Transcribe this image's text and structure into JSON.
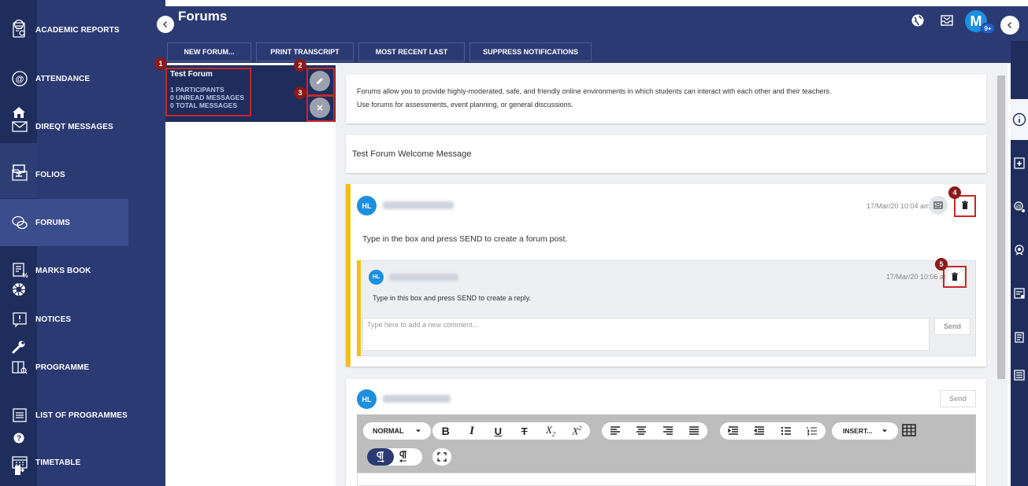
{
  "header": {
    "title": "Forums",
    "avatar_initial": "M",
    "badge": "9+"
  },
  "toolbar": {
    "new_forum": "NEW FORUM...",
    "print_transcript": "PRINT TRANSCRIPT",
    "most_recent_last": "MOST RECENT LAST",
    "suppress_notifications": "SUPPRESS NOTIFICATIONS"
  },
  "nav": {
    "items": [
      {
        "label": "ACADEMIC REPORTS"
      },
      {
        "label": "ATTENDANCE"
      },
      {
        "label": "DIREQT MESSAGES"
      },
      {
        "label": "FOLIOS"
      },
      {
        "label": "FORUMS"
      },
      {
        "label": "MARKS BOOK"
      },
      {
        "label": "NOTICES"
      },
      {
        "label": "PROGRAMME"
      },
      {
        "label": "LIST OF PROGRAMMES"
      },
      {
        "label": "TIMETABLE"
      }
    ]
  },
  "forum": {
    "title": "Test Forum",
    "participants": "1 PARTICIPANTS",
    "unread": "0 UNREAD MESSAGES",
    "total": "0 TOTAL MESSAGES"
  },
  "callouts": [
    "1",
    "2",
    "3",
    "4",
    "5"
  ],
  "content": {
    "info_line1": "Forums allow you to provide highly-moderated, safe, and friendly online environments in which students can interact with each other and their teachers.",
    "info_line2": "Use forums for assessments, event planning, or general discussions.",
    "welcome": "Test Forum Welcome Message"
  },
  "post": {
    "initials": "HL",
    "timestamp": "17/Mar/20 10:04 am",
    "text": "Type in the box and press SEND to create a forum post."
  },
  "reply": {
    "initials": "HL",
    "timestamp": "17/Mar/20 10:06 am",
    "text": "Type in this box and press SEND to create a reply."
  },
  "comment": {
    "placeholder": "Type here to add a new comment...",
    "send": "Send"
  },
  "new_post": {
    "initials": "HL",
    "send": "Send"
  },
  "editor": {
    "format": "NORMAL",
    "insert": "INSERT..."
  },
  "colors": {
    "sidebar": "#2b3a73",
    "rail": "#1e2d5c",
    "accent": "#1d8fe0",
    "post_bar": "#f2be1d",
    "callout": "#8b1a1a"
  }
}
